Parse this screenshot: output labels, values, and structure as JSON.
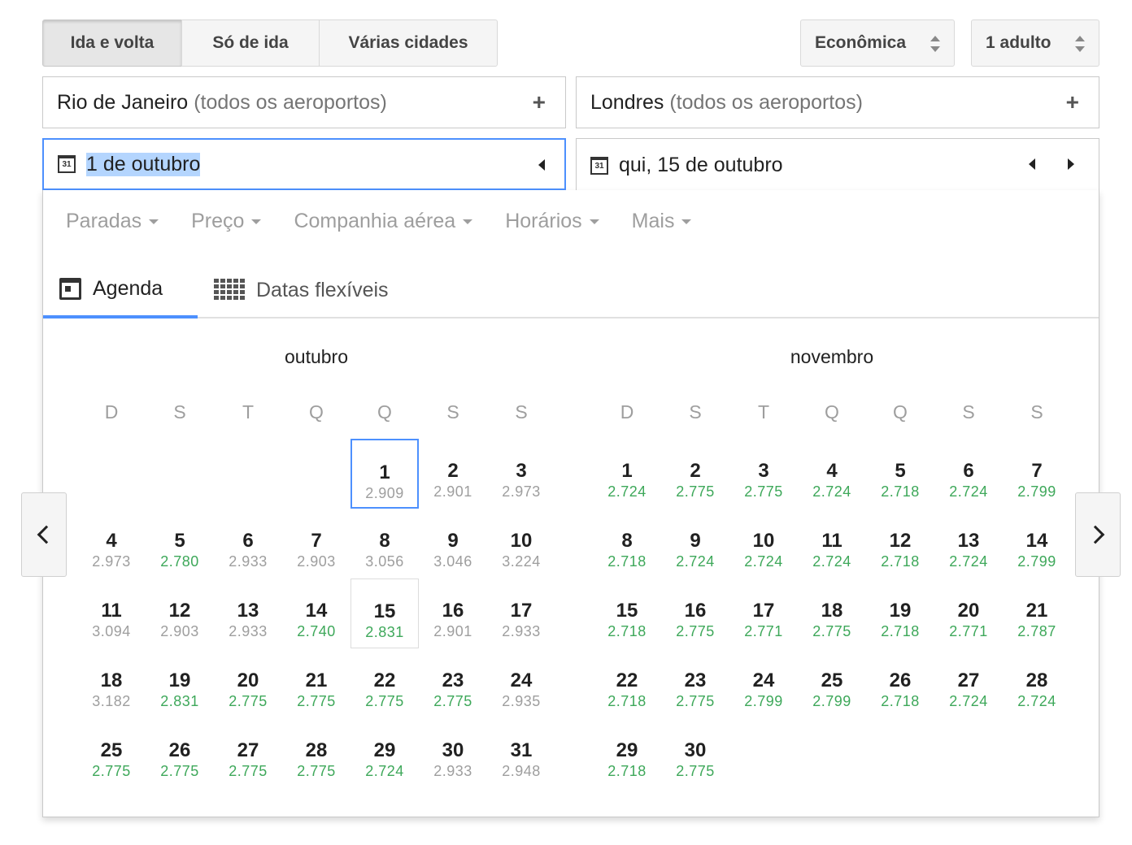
{
  "trip_type": {
    "options": [
      "Ida e volta",
      "Só de ida",
      "Várias cidades"
    ],
    "selected": "Ida e volta"
  },
  "cabin_class": {
    "value": "Econômica",
    "icon": "sort-arrows-icon"
  },
  "passengers": {
    "value": "1 adulto",
    "icon": "sort-arrows-icon"
  },
  "origin": {
    "city": "Rio de Janeiro",
    "detail": "(todos os aeroportos)",
    "action": "+"
  },
  "destination": {
    "city": "Londres",
    "detail": "(todos os aeroportos)",
    "action": "+"
  },
  "depart_date": {
    "icon_text": "31",
    "value": "1 de outubro"
  },
  "return_date": {
    "icon_text": "31",
    "value": "qui, 15 de outubro"
  },
  "filters": [
    "Paradas",
    "Preço",
    "Companhia aérea",
    "Horários",
    "Mais"
  ],
  "tabs": [
    {
      "label": "Agenda",
      "icon": "calendar-icon",
      "active": true
    },
    {
      "label": "Datas flexíveis",
      "icon": "grid-icon",
      "active": false
    }
  ],
  "weekdays": [
    "D",
    "S",
    "T",
    "Q",
    "Q",
    "S",
    "S"
  ],
  "colors": {
    "accent": "#4d90fe",
    "low_price": "#3ea85a",
    "normal_price": "#9e9e9e"
  },
  "months": [
    {
      "name": "outubro",
      "first_weekday": 4,
      "days": [
        {
          "d": "1",
          "p": "2.909",
          "low": false
        },
        {
          "d": "2",
          "p": "2.901",
          "low": false
        },
        {
          "d": "3",
          "p": "2.973",
          "low": false
        },
        {
          "d": "4",
          "p": "2.973",
          "low": false
        },
        {
          "d": "5",
          "p": "2.780",
          "low": true
        },
        {
          "d": "6",
          "p": "2.933",
          "low": false
        },
        {
          "d": "7",
          "p": "2.903",
          "low": false
        },
        {
          "d": "8",
          "p": "3.056",
          "low": false
        },
        {
          "d": "9",
          "p": "3.046",
          "low": false
        },
        {
          "d": "10",
          "p": "3.224",
          "low": false
        },
        {
          "d": "11",
          "p": "3.094",
          "low": false
        },
        {
          "d": "12",
          "p": "2.903",
          "low": false
        },
        {
          "d": "13",
          "p": "2.933",
          "low": false
        },
        {
          "d": "14",
          "p": "2.740",
          "low": true
        },
        {
          "d": "15",
          "p": "2.831",
          "low": true
        },
        {
          "d": "16",
          "p": "2.901",
          "low": false
        },
        {
          "d": "17",
          "p": "2.933",
          "low": false
        },
        {
          "d": "18",
          "p": "3.182",
          "low": false
        },
        {
          "d": "19",
          "p": "2.831",
          "low": true
        },
        {
          "d": "20",
          "p": "2.775",
          "low": true
        },
        {
          "d": "21",
          "p": "2.775",
          "low": true
        },
        {
          "d": "22",
          "p": "2.775",
          "low": true
        },
        {
          "d": "23",
          "p": "2.775",
          "low": true
        },
        {
          "d": "24",
          "p": "2.935",
          "low": false
        },
        {
          "d": "25",
          "p": "2.775",
          "low": true
        },
        {
          "d": "26",
          "p": "2.775",
          "low": true
        },
        {
          "d": "27",
          "p": "2.775",
          "low": true
        },
        {
          "d": "28",
          "p": "2.775",
          "low": true
        },
        {
          "d": "29",
          "p": "2.724",
          "low": true
        },
        {
          "d": "30",
          "p": "2.933",
          "low": false
        },
        {
          "d": "31",
          "p": "2.948",
          "low": false
        }
      ],
      "selected_start": "1",
      "selected_end": "15"
    },
    {
      "name": "novembro",
      "first_weekday": 0,
      "days": [
        {
          "d": "1",
          "p": "2.724",
          "low": true
        },
        {
          "d": "2",
          "p": "2.775",
          "low": true
        },
        {
          "d": "3",
          "p": "2.775",
          "low": true
        },
        {
          "d": "4",
          "p": "2.724",
          "low": true
        },
        {
          "d": "5",
          "p": "2.718",
          "low": true
        },
        {
          "d": "6",
          "p": "2.724",
          "low": true
        },
        {
          "d": "7",
          "p": "2.799",
          "low": true
        },
        {
          "d": "8",
          "p": "2.718",
          "low": true
        },
        {
          "d": "9",
          "p": "2.724",
          "low": true
        },
        {
          "d": "10",
          "p": "2.724",
          "low": true
        },
        {
          "d": "11",
          "p": "2.724",
          "low": true
        },
        {
          "d": "12",
          "p": "2.718",
          "low": true
        },
        {
          "d": "13",
          "p": "2.724",
          "low": true
        },
        {
          "d": "14",
          "p": "2.799",
          "low": true
        },
        {
          "d": "15",
          "p": "2.718",
          "low": true
        },
        {
          "d": "16",
          "p": "2.775",
          "low": true
        },
        {
          "d": "17",
          "p": "2.771",
          "low": true
        },
        {
          "d": "18",
          "p": "2.775",
          "low": true
        },
        {
          "d": "19",
          "p": "2.718",
          "low": true
        },
        {
          "d": "20",
          "p": "2.771",
          "low": true
        },
        {
          "d": "21",
          "p": "2.787",
          "low": true
        },
        {
          "d": "22",
          "p": "2.718",
          "low": true
        },
        {
          "d": "23",
          "p": "2.775",
          "low": true
        },
        {
          "d": "24",
          "p": "2.799",
          "low": true
        },
        {
          "d": "25",
          "p": "2.799",
          "low": true
        },
        {
          "d": "26",
          "p": "2.718",
          "low": true
        },
        {
          "d": "27",
          "p": "2.724",
          "low": true
        },
        {
          "d": "28",
          "p": "2.724",
          "low": true
        },
        {
          "d": "29",
          "p": "2.718",
          "low": true
        },
        {
          "d": "30",
          "p": "2.775",
          "low": true
        }
      ],
      "selected_start": null,
      "selected_end": null
    }
  ],
  "nav": {
    "prev_icon": "chevron-left-icon",
    "next_icon": "chevron-right-icon"
  }
}
